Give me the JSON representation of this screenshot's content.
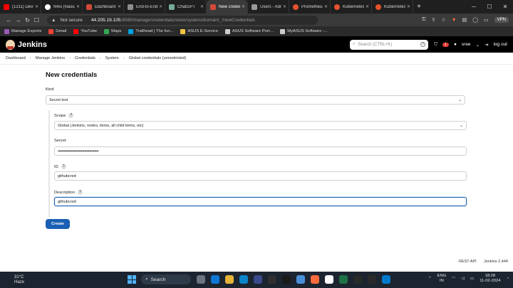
{
  "browser": {
    "tabs": [
      {
        "title": "(1211) DevSec",
        "color": "#ff0000"
      },
      {
        "title": "N4si (Nasiullhu",
        "color": "#ffffff"
      },
      {
        "title": "Dashboard [Mi",
        "color": "#d24939"
      },
      {
        "title": "End-to-End De",
        "color": "#8e8e8e"
      },
      {
        "title": "ChatGPT",
        "color": "#74aa9c"
      },
      {
        "title": "New creden",
        "color": "#d24939",
        "active": true
      },
      {
        "title": "Users - Admin",
        "color": "#9a9a9a"
      },
      {
        "title": "Prometheus Ti",
        "color": "#e6522c"
      },
      {
        "title": "Kubernetes Cl",
        "color": "#e6522c"
      },
      {
        "title": "Kubernetes Cl",
        "color": "#e6522c"
      }
    ],
    "new_tab": "+",
    "address": {
      "security": "Not secure",
      "host": "44.205.19.105",
      "path": ":8080/manage/credentials/store/system/domain/_/newCredentials"
    },
    "vpn": "VPN",
    "bookmarks": [
      {
        "label": "Manage Exports",
        "color": "#9b59b6"
      },
      {
        "label": "Gmail",
        "color": "#ea4335"
      },
      {
        "label": "YouTube",
        "color": "#ff0000"
      },
      {
        "label": "Maps",
        "color": "#34a853"
      },
      {
        "label": "Trailhead | The fun...",
        "color": "#00a1e0"
      },
      {
        "label": "ASUS E-Service",
        "color": "#f4c542"
      },
      {
        "label": "ASUS Software Port...",
        "color": "#cccccc"
      },
      {
        "label": "MyASUS Software -...",
        "color": "#cccccc"
      }
    ]
  },
  "jenkins": {
    "title": "Jenkins",
    "search_placeholder": "Search (CTRL+K)",
    "notif_count": "1",
    "user": "sree",
    "logout": "log out"
  },
  "breadcrumb": [
    "Dashboard",
    "Manage Jenkins",
    "Credentials",
    "System",
    "Global credentials (unrestricted)"
  ],
  "form": {
    "title": "New credentials",
    "kind_label": "Kind",
    "kind_value": "Secret text",
    "scope_label": "Scope",
    "scope_value": "Global (Jenkins, nodes, items, all child items, etc)",
    "secret_label": "Secret",
    "secret_value": "••••••••••••••••••••••••••••••••••••••••",
    "id_label": "ID",
    "id_value": "githubcred",
    "description_label": "Description",
    "description_value": "githubcred",
    "help": "?",
    "create": "Create"
  },
  "footer": {
    "rest_api": "REST API",
    "version": "Jenkins 2.444"
  },
  "taskbar": {
    "weather_temp": "31°C",
    "weather_desc": "Haze",
    "search": "Search",
    "lang1": "ENG",
    "lang2": "IN",
    "time": "18:28",
    "date": "11-02-2024"
  }
}
